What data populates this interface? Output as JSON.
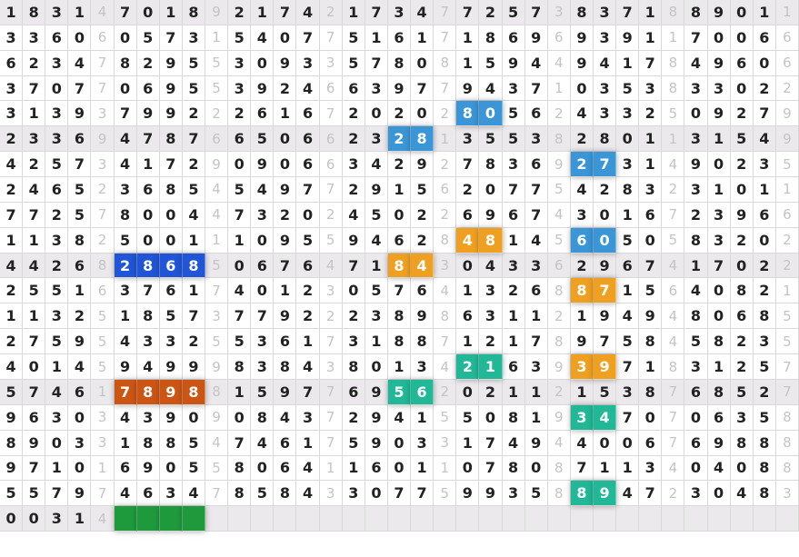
{
  "colors": {
    "blue_light": "#3a96d6",
    "blue_dark": "#1f55d6",
    "orange": "#f0a020",
    "teal": "#20b896",
    "rust": "#cc5514",
    "green": "#1e9a3c"
  },
  "shaded_rows": [
    0,
    5,
    10,
    15,
    20
  ],
  "rows": [
    "1831 4 7018 9 2174 2 1734 7 7257 3 8371 8 8901 1",
    "3360 6 0573 1 5407 7 5161 7 1869 6 9391 1 7006 6",
    "6234 7 8295 5 3093 3 5780 8 1594 4 9417 8 4960 6",
    "3707 7 0695 5 3924 6 6397 7 9437 1 0353 8 3302 2",
    "3139 3 7992 2 2616 7 2020 2 8056 2 4332 5 0927 9",
    "2336 9 4787 6 6506 6 2328 1 3553 8 2801 1 3154 9",
    "4257 3 4172 9 0906 6 3429 2 7836 9 2731 4 9023 5",
    "2465 2 3685 4 5497 7 2915 6 2077 5 4283 2 3101 1",
    "7725 7 8004 4 7320 2 4502 2 6967 4 3016 7 2396 6",
    "1138 2 5001 1 1095 5 9462 8 4814 5 6050 5 8320 2",
    "4426 8 2868 5 0676 4 7184 3 0433 6 2967 4 1702 2",
    "2551 6 3761 7 4012 3 0576 4 1326 8 8715 6 4082 1",
    "1132 5 1857 3 7792 2 2389 8 6311 2 1949 4 8068 5",
    "2759 5 4332 5 5361 7 3188 7 1217 8 9758 4 5823 5",
    "4014 5 9499 9 8384 3 8013 4 2163 9 3971 8 3125 7",
    "5746 1 7898 8 1597 7 6956 2 0211 2 1538 7 6852 7",
    "9630 3 4390 9 0843 7 2941 5 5081 9 3470 7 0635 8",
    "8903 3 1885 4 7461 7 5903 3 1749 4 4006 7 6988 8",
    "9710 1 6905 5 8064 1 1601 1 0780 8 7113 4 0408 8",
    "5579 7 4634 7 8584 3 3077 5 9935 8 8947 2 3048 3",
    "0031 4 .... . .... . .... . .... . .... . .... ."
  ],
  "highlights": [
    {
      "row": 4,
      "cols": [
        20,
        21
      ],
      "color": "blue_light"
    },
    {
      "row": 5,
      "cols": [
        17,
        18
      ],
      "color": "blue_light"
    },
    {
      "row": 6,
      "cols": [
        25,
        26
      ],
      "color": "blue_light"
    },
    {
      "row": 9,
      "cols": [
        20,
        21
      ],
      "color": "orange"
    },
    {
      "row": 9,
      "cols": [
        25,
        26
      ],
      "color": "blue_light"
    },
    {
      "row": 10,
      "cols": [
        5,
        6,
        7,
        8
      ],
      "color": "blue_dark"
    },
    {
      "row": 10,
      "cols": [
        17,
        18
      ],
      "color": "orange"
    },
    {
      "row": 11,
      "cols": [
        25,
        26
      ],
      "color": "orange"
    },
    {
      "row": 14,
      "cols": [
        20,
        21
      ],
      "color": "teal"
    },
    {
      "row": 14,
      "cols": [
        25,
        26
      ],
      "color": "orange"
    },
    {
      "row": 15,
      "cols": [
        5,
        6,
        7,
        8
      ],
      "color": "rust"
    },
    {
      "row": 15,
      "cols": [
        17,
        18
      ],
      "color": "teal"
    },
    {
      "row": 16,
      "cols": [
        25,
        26
      ],
      "color": "teal"
    },
    {
      "row": 19,
      "cols": [
        25,
        26
      ],
      "color": "teal"
    },
    {
      "row": 20,
      "cols": [
        5,
        6,
        7,
        8
      ],
      "color": "green"
    }
  ]
}
